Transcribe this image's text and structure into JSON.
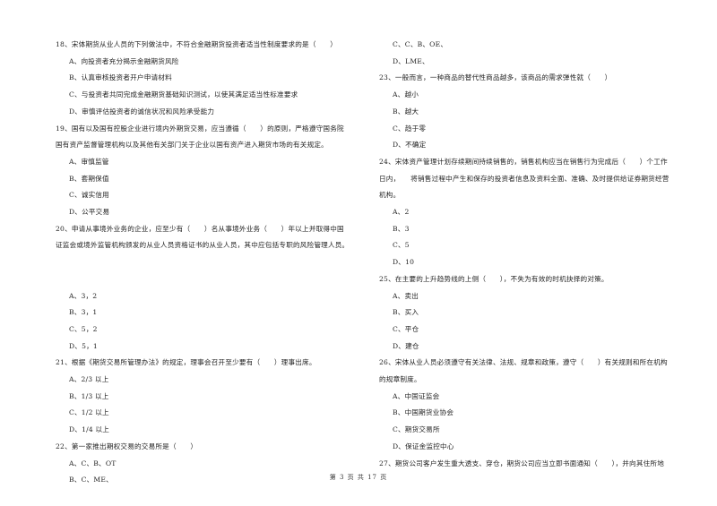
{
  "left_column": {
    "q18": {
      "stem": "18、宋体期货从业人员的下列做法中，不符合金融期货投资者适当性制度要求的是（　　）",
      "options": [
        "A、向投资者充分揭示金融期货风险",
        "B、认真审核投资者开户申请材料",
        "C、与投资者共同完成金融期货基础知识测试，以使其满足适当性标准要求",
        "D、审慎评估投资者的诚信状况和风险承受能力"
      ]
    },
    "q19": {
      "stem_lines": [
        "19、国有以及国有控股企业进行境内外期货交易，应当遵循（　　）的原则，严格遵守国务院",
        "国有资产监督管理机构以及其他有关部门关于企业以国有资产进入期货市场的有关规定。"
      ],
      "options": [
        "A、审慎监管",
        "B、套期保值",
        "C、诚实信用",
        "D、公平交易"
      ]
    },
    "q20": {
      "stem_lines": [
        "20、申请从事境外业务的企业，应至少有（　　）名从事境外业务（　　）年以上并取得中国",
        "证监会或境外监管机构颁发的从业人员资格证书的从业人员，其中应包括专职的风险管理人员。"
      ],
      "options": [
        "A、3，2",
        "B、3，1",
        "C、5，2",
        "D、5，1"
      ]
    },
    "q21": {
      "stem": "21、根据《期货交易所管理办法》的规定，理事会召开至少要有（　　）理事出席。",
      "options": [
        "A、2/3 以上",
        "B、1/3 以上",
        "C、1/2 以上",
        "D、1/4 以上"
      ]
    },
    "q22": {
      "stem": "22、第一家推出期权交易的交易所是（　　）",
      "options": [
        "A、C、B、OT",
        "B、C、ME、"
      ]
    }
  },
  "right_column": {
    "q22_cont": {
      "options": [
        "C、C、B、OE、",
        "D、LME、"
      ]
    },
    "q23": {
      "stem": "23、一般而言，一种商品的替代性商品越多，该商品的需求弹性就（　　）",
      "options": [
        "A、越小",
        "B、越大",
        "C、趋于零",
        "D、不确定"
      ]
    },
    "q24": {
      "stem_lines": [
        "24、宋体资产管理计划存续期间持续销售的，销售机构应当在销售行为完成后（　　）个工作",
        "日内，　　将销售过程中产生和保存的投资者信息及资料全面、准确、及时提供给证券期货经营",
        "机构。"
      ],
      "options": [
        "A、2",
        "B、3",
        "C、5",
        "D、10"
      ]
    },
    "q25": {
      "stem": "25、在主要的上升趋势线的上侧（　　），不失为有效的时机抉择的对策。",
      "options": [
        "A、卖出",
        "B、买入",
        "C、平仓",
        "D、建仓"
      ]
    },
    "q26": {
      "stem_lines": [
        "26、宋体从业人员必须遵守有关法律、法规、规章和政策，遵守（　　）有关规则和所在机构",
        "的规章制度。"
      ],
      "options": [
        "A、中国证监会",
        "B、中国期货业协会",
        "C、期货交易所",
        "D、保证金监控中心"
      ]
    },
    "q27": {
      "stem": "27、期货公司客户发生重大透支、穿仓，期货公司应当立即书面通知（　　），并向其住所地"
    }
  },
  "footer": {
    "page_label": "第 3 页 共 17 页"
  }
}
